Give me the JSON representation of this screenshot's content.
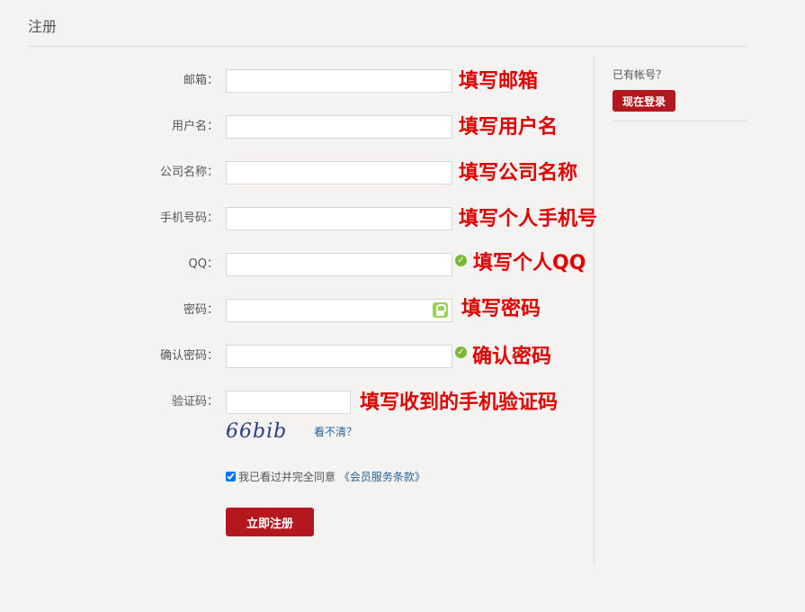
{
  "page": {
    "title": "注册"
  },
  "form": {
    "email": {
      "label": "邮箱：",
      "value": "",
      "hint": "填写邮箱"
    },
    "username": {
      "label": "用户名：",
      "value": "",
      "hint": "填写用户名"
    },
    "company": {
      "label": "公司名称：",
      "value": "",
      "hint": "填写公司名称"
    },
    "phone": {
      "label": "手机号码：",
      "value": "",
      "hint": "填写个人手机号"
    },
    "qq": {
      "label": "QQ：",
      "value": "",
      "hint": "填写个人QQ"
    },
    "password": {
      "label": "密码：",
      "value": "",
      "hint": "填写密码"
    },
    "confirm": {
      "label": "确认密码：",
      "value": "",
      "hint": "确认密码"
    },
    "code": {
      "label": "验证码：",
      "value": "",
      "hint": "填写收到的手机验证码"
    },
    "captcha": {
      "text": "66bib",
      "refresh_label": "看不清？"
    },
    "agree": {
      "checked": true,
      "text": "我已看过并完全同意",
      "link": "《会员服务条款》"
    },
    "submit_label": "立即注册"
  },
  "sidebar": {
    "question": "已有帐号？",
    "login_label": "现在登录"
  },
  "colors": {
    "accent": "#b5171e",
    "hint": "#e00000",
    "ok": "#7ab836"
  }
}
